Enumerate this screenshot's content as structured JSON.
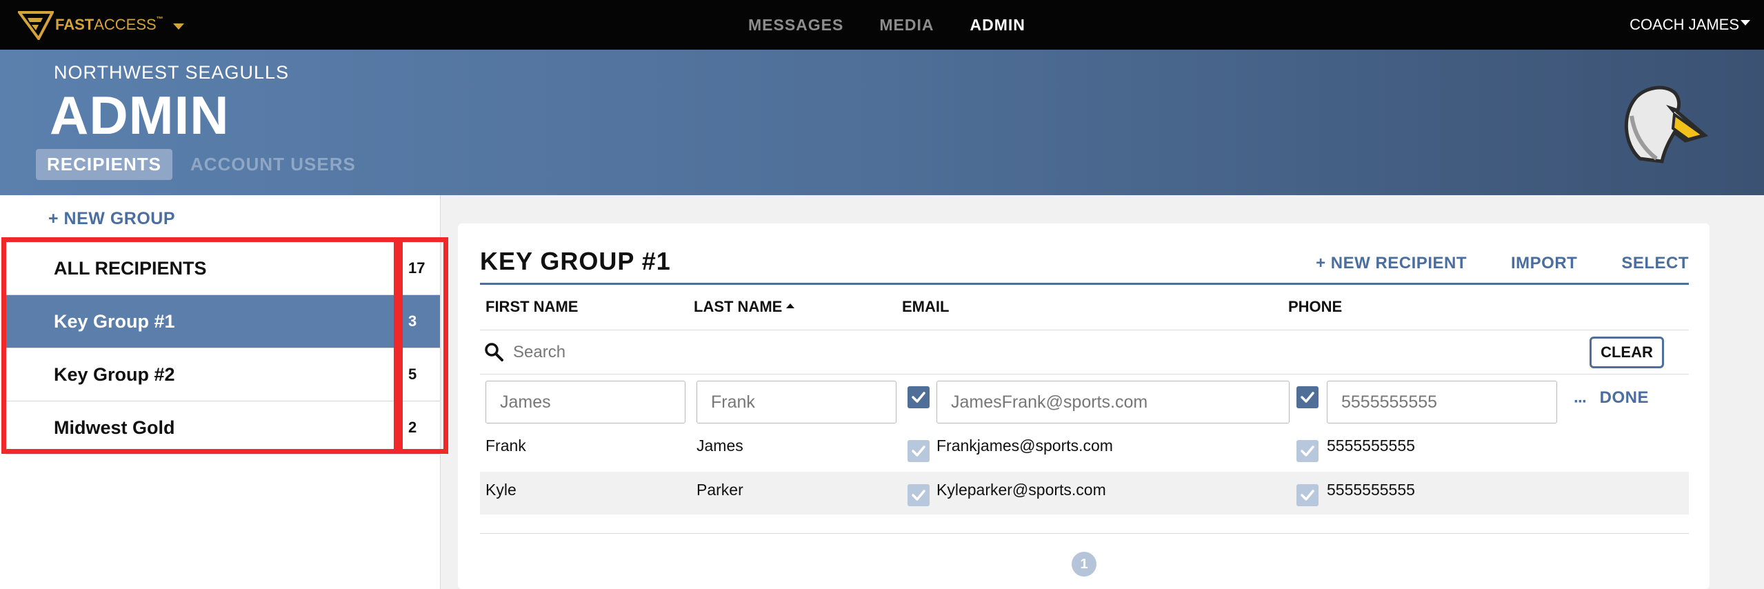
{
  "app": {
    "brand_fast": "FAST",
    "brand_access": "ACCESS",
    "brand_tm": "™",
    "nav": [
      "MESSAGES",
      "MEDIA",
      "ADMIN"
    ],
    "active_nav": "ADMIN",
    "user": "COACH JAMES"
  },
  "header": {
    "org": "NORTHWEST SEAGULLS",
    "title": "ADMIN",
    "tabs": [
      "RECIPIENTS",
      "ACCOUNT USERS"
    ],
    "active_tab": "RECIPIENTS"
  },
  "sidebar": {
    "new_group": "+ NEW GROUP",
    "groups": [
      {
        "name": "ALL RECIPIENTS",
        "count": "17"
      },
      {
        "name": "Key Group #1",
        "count": "3",
        "selected": true
      },
      {
        "name": "Key Group #2",
        "count": "5"
      },
      {
        "name": "Midwest Gold",
        "count": "2"
      }
    ]
  },
  "panel": {
    "title": "KEY GROUP #1",
    "actions": [
      "+ NEW RECIPIENT",
      "IMPORT",
      "SELECT"
    ],
    "columns": [
      "FIRST NAME",
      "LAST NAME",
      "EMAIL",
      "PHONE"
    ],
    "sort_column": "LAST NAME",
    "search_placeholder": "Search",
    "clear_label": "CLEAR",
    "editing_row": {
      "first_name": "James",
      "last_name": "Frank",
      "email": "JamesFrank@sports.com",
      "email_checked": true,
      "phone": "5555555555",
      "phone_checked": true,
      "more_label": "···",
      "done_label": "DONE"
    },
    "rows": [
      {
        "first_name": "Frank",
        "last_name": "James",
        "email": "Frankjames@sports.com",
        "phone": "5555555555"
      },
      {
        "first_name": "Kyle",
        "last_name": "Parker",
        "email": "Kyleparker@sports.com",
        "phone": "5555555555"
      }
    ],
    "page": "1"
  },
  "colors": {
    "accent": "#4f6f98",
    "brand_gold": "#d4a43a",
    "highlight_red": "#f0282a"
  }
}
